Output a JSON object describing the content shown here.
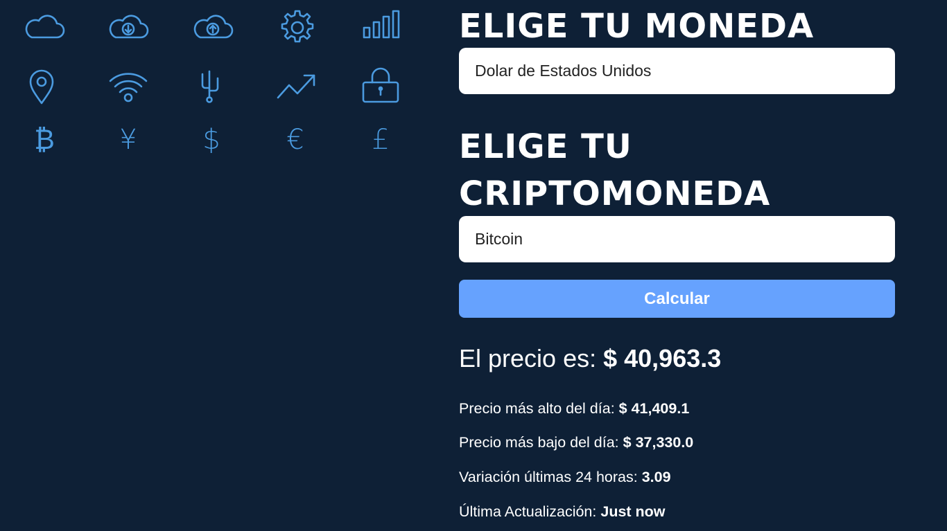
{
  "icons": {
    "row1": [
      "cloud-icon",
      "cloud-download-icon",
      "cloud-upload-icon",
      "gear-icon",
      "bar-chart-icon"
    ],
    "row2": [
      "location-pin-icon",
      "wifi-icon",
      "usb-icon",
      "trend-up-icon",
      "lock-icon"
    ],
    "row3": [
      {
        "name": "bitcoin-icon",
        "glyph": "₿"
      },
      {
        "name": "yen-icon",
        "glyph": "¥"
      },
      {
        "name": "dollar-icon",
        "glyph": "$"
      },
      {
        "name": "euro-icon",
        "glyph": "€"
      },
      {
        "name": "pound-icon",
        "glyph": "£"
      }
    ],
    "color": "#4b9be0"
  },
  "form": {
    "currency_heading": "ELIGE TU MONEDA",
    "currency_selected": "Dolar de Estados Unidos",
    "crypto_heading_line1": "ELIGE TU",
    "crypto_heading_line2": "CRIPTOMONEDA",
    "crypto_selected": "Bitcoin",
    "submit_label": "Calcular",
    "button_color": "#66a2fe"
  },
  "result": {
    "price_label": "El precio es:",
    "price_value": "$ 40,963.3",
    "high_label": "Precio más alto del día:",
    "high_value": "$ 41,409.1",
    "low_label": "Precio más bajo del día:",
    "low_value": "$ 37,330.0",
    "change_label": "Variación últimas 24 horas:",
    "change_value": "3.09",
    "updated_label": "Última Actualización:",
    "updated_value": "Just now"
  },
  "colors": {
    "background": "#0e2036"
  }
}
